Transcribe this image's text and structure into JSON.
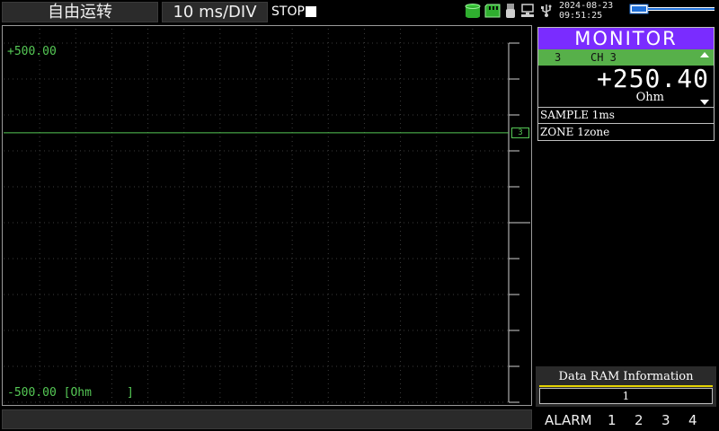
{
  "topbar": {
    "mode": "自由运转",
    "timebase": "10 ms/DIV",
    "stop_label": "STOP",
    "date": "2024-08-23",
    "time": "09:51:25",
    "icons": [
      "memory-green-icon",
      "sd-card-icon",
      "usb-icon",
      "network-icon",
      "usb-plug-icon",
      "battery-icon"
    ]
  },
  "waveform": {
    "scale_max": "+500.00",
    "scale_min": "-500.00 [Ohm     ]",
    "channel_marker": "3",
    "trace_value": 250.4,
    "range_max": 500,
    "range_min": -500,
    "trace_color": "#55c855"
  },
  "monitor": {
    "title": "MONITOR",
    "channel_number": "3",
    "channel_name": "CH 3",
    "value": "+250.40",
    "unit": "Ohm",
    "sample": "SAMPLE  1ms",
    "zone": "ZONE     1zone",
    "title_color": "#7a2cff",
    "channel_bar_color": "#57b04a"
  },
  "ram": {
    "title": "Data RAM Information",
    "value": "1"
  },
  "alarm": {
    "label": "ALARM",
    "channels": [
      "1",
      "2",
      "3",
      "4"
    ]
  }
}
